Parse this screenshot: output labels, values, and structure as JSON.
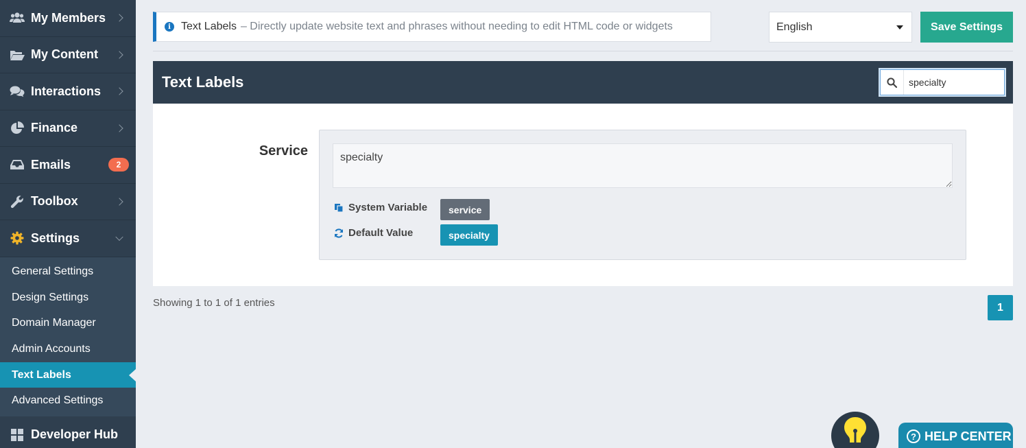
{
  "sidebar": {
    "items": [
      {
        "label": "My Members",
        "icon": "users-icon"
      },
      {
        "label": "My Content",
        "icon": "folder-open-icon"
      },
      {
        "label": "Interactions",
        "icon": "comments-icon"
      },
      {
        "label": "Finance",
        "icon": "pie-chart-icon"
      },
      {
        "label": "Emails",
        "icon": "inbox-icon",
        "badge": "2"
      },
      {
        "label": "Toolbox",
        "icon": "wrench-icon"
      },
      {
        "label": "Settings",
        "icon": "gear-icon"
      }
    ],
    "settings_sub": [
      {
        "label": "General Settings"
      },
      {
        "label": "Design Settings"
      },
      {
        "label": "Domain Manager"
      },
      {
        "label": "Admin Accounts"
      },
      {
        "label": "Text Labels"
      },
      {
        "label": "Advanced Settings"
      }
    ],
    "partial_item": "Developer Hub"
  },
  "info": {
    "title": "Text Labels",
    "description": "– Directly update website text and phrases without needing to edit HTML code or widgets"
  },
  "language": {
    "selected": "English"
  },
  "save_label": "Save Settings",
  "panel": {
    "title": "Text Labels",
    "search_value": "specialty"
  },
  "entry": {
    "label": "Service",
    "value": "specialty",
    "system_variable_label": "System Variable",
    "system_variable": "service",
    "default_value_label": "Default Value",
    "default_value": "specialty"
  },
  "showing_text": "Showing 1 to 1 of 1 entries",
  "page_number": "1",
  "help_label": "HELP CENTER",
  "colors": {
    "sidebar_bg": "#2f3f4f",
    "accent_teal": "#1793b3",
    "save_green": "#27a88f",
    "badge_orange": "#f36d4f",
    "info_blue": "#1a76c0"
  }
}
